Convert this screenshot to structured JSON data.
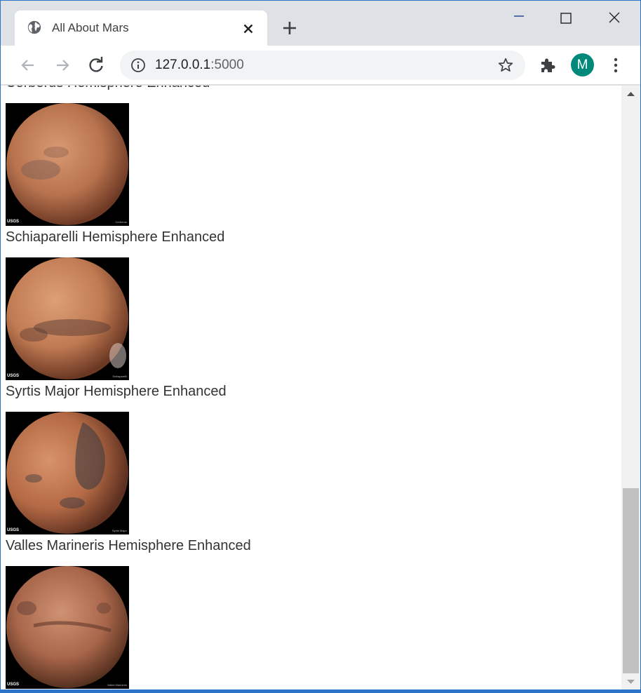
{
  "browser": {
    "tab_title": "All About Mars",
    "url_host": "127.0.0.1",
    "url_port": ":5000",
    "profile_initial": "M",
    "profile_color": "#00897b"
  },
  "hemispheres": [
    {
      "title": "Cerberus Hemisphere Enhanced",
      "image_label": "Cerberus",
      "tint": "#b8734e"
    },
    {
      "title": "Schiaparelli Hemisphere Enhanced",
      "image_label": "Schiaparelli",
      "tint": "#c07a52"
    },
    {
      "title": "Syrtis Major Hemisphere Enhanced",
      "image_label": "Syrtis Major",
      "tint": "#b46a45"
    },
    {
      "title": "Valles Marineris Hemisphere Enhanced",
      "image_label": "Valles Marineris",
      "tint": "#a8664a"
    }
  ],
  "image_logo_text": "USGS",
  "scrollbar": {
    "position_fraction": 0.95
  }
}
